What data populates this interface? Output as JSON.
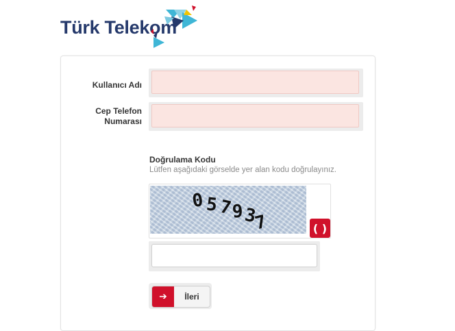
{
  "brand": {
    "name": "Türk Telekom",
    "text_color": "#25396b",
    "accent_colors": [
      "#d0112b",
      "#25396b",
      "#3fb6d6",
      "#f2c400"
    ]
  },
  "form": {
    "username_label": "Kullanıcı Adı",
    "phone_label_line1": "Cep Telefon",
    "phone_label_line2": "Numarası",
    "username_value": "",
    "phone_value": "",
    "field_fill_color": "#fbe5e1"
  },
  "verification": {
    "title": "Doğrulama Kodu",
    "hint": "Lütfen aşağıdaki görselde yer alan kodu doğrulayınız.",
    "captcha_text": "057937",
    "refresh_icon": "refresh-icon",
    "code_value": ""
  },
  "actions": {
    "next_label": "İleri",
    "next_icon": "arrow-right-icon",
    "accent": "#d0112b"
  }
}
